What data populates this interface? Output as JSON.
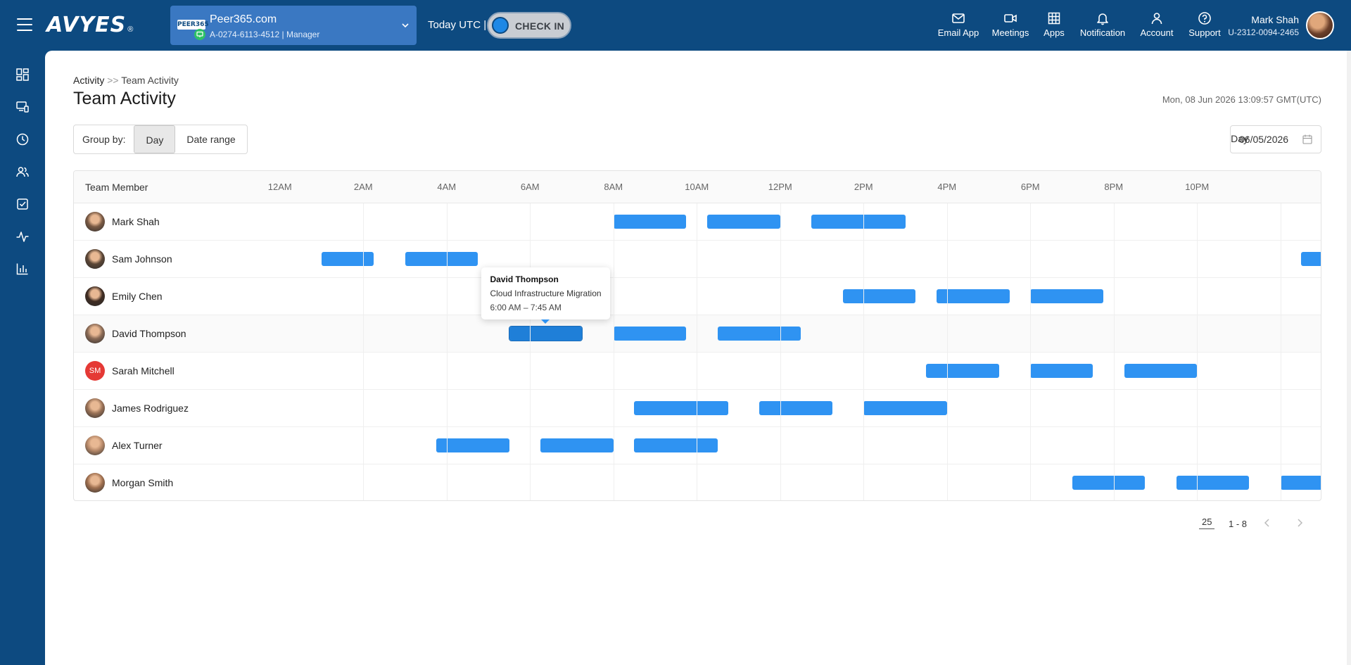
{
  "header": {
    "logo_text": "AVYES",
    "org": {
      "name": "Peer365.com",
      "sub": "A-0274-6113-4512 | Manager",
      "logo_text": "PEER365"
    },
    "today_label": "Today UTC  |",
    "checkin_label": "CHECK IN",
    "nav": [
      {
        "label": "Email App",
        "icon": "email-icon"
      },
      {
        "label": "Meetings",
        "icon": "video-icon"
      },
      {
        "label": "Apps",
        "icon": "grid-icon"
      },
      {
        "label": "Notification",
        "icon": "bell-icon"
      },
      {
        "label": "Account",
        "icon": "user-icon"
      },
      {
        "label": "Support",
        "icon": "help-icon"
      }
    ],
    "user": {
      "name": "Mark Shah",
      "id": "U-2312-0094-2465"
    }
  },
  "sidebar": {
    "items": [
      {
        "icon": "dashboard-icon"
      },
      {
        "icon": "devices-icon"
      },
      {
        "icon": "clock-icon"
      },
      {
        "icon": "users-icon"
      },
      {
        "icon": "checkbox-icon"
      },
      {
        "icon": "activity-icon"
      },
      {
        "icon": "bar-chart-icon"
      }
    ]
  },
  "page": {
    "breadcrumb": {
      "parent": "Activity",
      "sep": ">>",
      "current": "Team Activity"
    },
    "title": "Team Activity",
    "datetime": "Mon, 08 Jun 2026 13:09:57 GMT(UTC)",
    "group_by": {
      "label": "Group by:",
      "options": [
        "Day",
        "Date range"
      ],
      "selected": "Day"
    },
    "day": {
      "label": "Day",
      "value": "06/05/2026"
    }
  },
  "timeline": {
    "member_header": "Team Member",
    "ticks": [
      "12AM",
      "2AM",
      "4AM",
      "6AM",
      "8AM",
      "10AM",
      "12PM",
      "2PM",
      "4PM",
      "6PM",
      "8PM",
      "10PM"
    ],
    "hours_visible": [
      0,
      24
    ],
    "members": [
      {
        "name": "Mark Shah",
        "avatar": "photo",
        "blocks": [
          [
            7,
            8.75
          ],
          [
            9.25,
            11
          ],
          [
            11.75,
            14
          ]
        ]
      },
      {
        "name": "Sam Johnson",
        "avatar": "photo",
        "blocks": [
          [
            -1.25,
            1.25
          ],
          [
            2,
            3.75
          ],
          [
            23.5,
            24.5
          ]
        ]
      },
      {
        "name": "Emily Chen",
        "avatar": "photo",
        "blocks": [
          [
            12.5,
            14.25
          ],
          [
            14.75,
            16.5
          ],
          [
            17,
            18.75
          ]
        ]
      },
      {
        "name": "David Thompson",
        "avatar": "photo",
        "blocks": [
          [
            4.5,
            6.25
          ],
          [
            7,
            8.75
          ],
          [
            9.5,
            11.5
          ]
        ]
      },
      {
        "name": "Sarah Mitchell",
        "avatar": "initials",
        "initials": "SM",
        "blocks": [
          [
            14.5,
            16.25
          ],
          [
            17,
            18.5
          ],
          [
            19.25,
            21
          ]
        ]
      },
      {
        "name": "James Rodriguez",
        "avatar": "photo",
        "blocks": [
          [
            7.5,
            9.75
          ],
          [
            10.5,
            12.25
          ],
          [
            13,
            15
          ]
        ]
      },
      {
        "name": "Alex Turner",
        "avatar": "photo",
        "blocks": [
          [
            2.75,
            4.5
          ],
          [
            5.25,
            7
          ],
          [
            7.5,
            9.5
          ]
        ]
      },
      {
        "name": "Morgan Smith",
        "avatar": "photo",
        "blocks": [
          [
            18,
            19.75
          ],
          [
            20.5,
            22.25
          ],
          [
            23,
            24.5
          ]
        ]
      }
    ],
    "tooltip": {
      "member_index": 3,
      "block_index": 0,
      "name": "David Thompson",
      "project": "Cloud Infrastructure Migration",
      "time": "6:00 AM – 7:45 AM"
    }
  },
  "pagination": {
    "page_size": "25",
    "range": "1 - 8"
  },
  "colors": {
    "brand": "#0d4a80",
    "bar": "#2f93f2",
    "accent": "#1e88e5"
  }
}
